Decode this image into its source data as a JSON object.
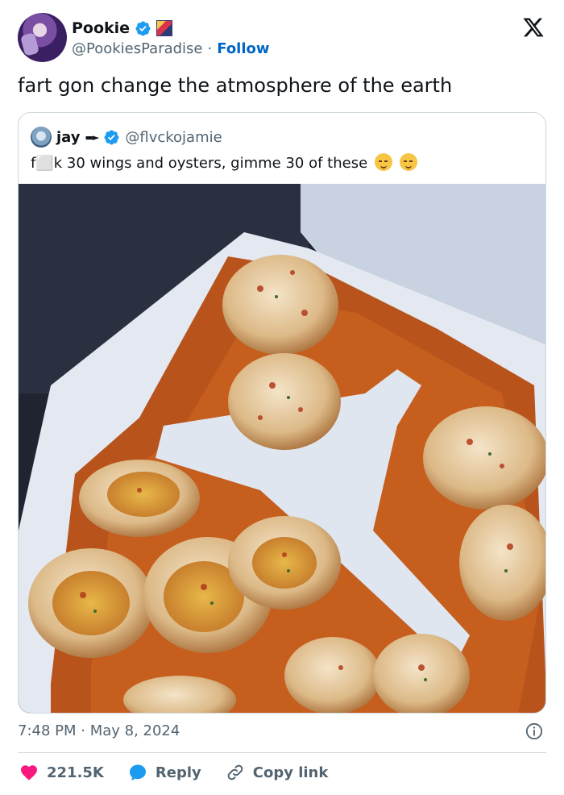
{
  "author": {
    "display_name": "Pookie",
    "handle": "@PookiesParadise",
    "separator": "·",
    "follow_label": "Follow"
  },
  "tweet": {
    "text": "fart gon change the atmosphere of the earth",
    "timestamp": "7:48 PM · May 8, 2024"
  },
  "quoted": {
    "display_name": "jay",
    "handle": "@flvckojamie",
    "text": "f⬜k 30 wings and oysters, gimme 30 of these",
    "image_alt": "styrofoam container of boiled eggs in spicy orange sauce"
  },
  "actions": {
    "likes": "221.5K",
    "reply_label": "Reply",
    "copy_label": "Copy link"
  },
  "colors": {
    "accent": "#1d9bf0",
    "like": "#f91880",
    "follow": "#0066c6",
    "muted": "#536471"
  }
}
